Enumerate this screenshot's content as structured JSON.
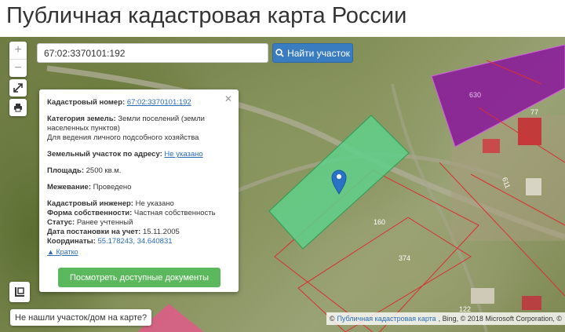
{
  "page_title": "Публичная кадастровая карта России",
  "map": {
    "zoom_in_label": "+",
    "zoom_out_label": "−",
    "parcel_labels": {
      "p160": "160",
      "p374": "374",
      "p77": "77",
      "p630": "630",
      "p611": "611",
      "p122": "122"
    }
  },
  "search": {
    "value": "67:02:3370101:192",
    "button_label": "Найти участок"
  },
  "info": {
    "cadastral_number_label": "Кадастровый номер:",
    "cadastral_number_value": "67:02:3370101:192",
    "category_label": "Категория земель:",
    "category_value": "Земли поселений (земли населенных пунктов)",
    "usage_value": "Для ведения личного подсобного хозяйства",
    "address_label": "Земельный участок по адресу:",
    "address_value": "Не указано",
    "area_label": "Площадь:",
    "area_value": "2500 кв.м.",
    "survey_label": "Межевание:",
    "survey_value": "Проведено",
    "engineer_label": "Кадастровый инженер:",
    "engineer_value": "Не указано",
    "ownership_label": "Форма собственности:",
    "ownership_value": "Частная собственность",
    "status_label": "Статус:",
    "status_value": "Ранее учтенный",
    "registration_label": "Дата постановки на учет:",
    "registration_value": "15.11.2005",
    "coords_label": "Координаты:",
    "coords_value": "55.178243, 34.640831",
    "collapse_label": "Кратко",
    "docs_button_label": "Посмотреть доступные документы"
  },
  "not_found_label": "Не нашли участок/дом на карте?",
  "attribution": {
    "prefix": "©",
    "link": "Публичная кадастровая карта",
    "rest": ", Bing, © 2018 Microsoft Corporation, ©"
  },
  "colors": {
    "parcel_green": "#5fd08a",
    "parcel_purple": "#8a1a9a",
    "parcel_pink": "#e05a8a",
    "boundary_red": "#d83030",
    "button_blue": "#3a7cc0",
    "button_green": "#5cb85c",
    "link_blue": "#2a6cb5"
  }
}
